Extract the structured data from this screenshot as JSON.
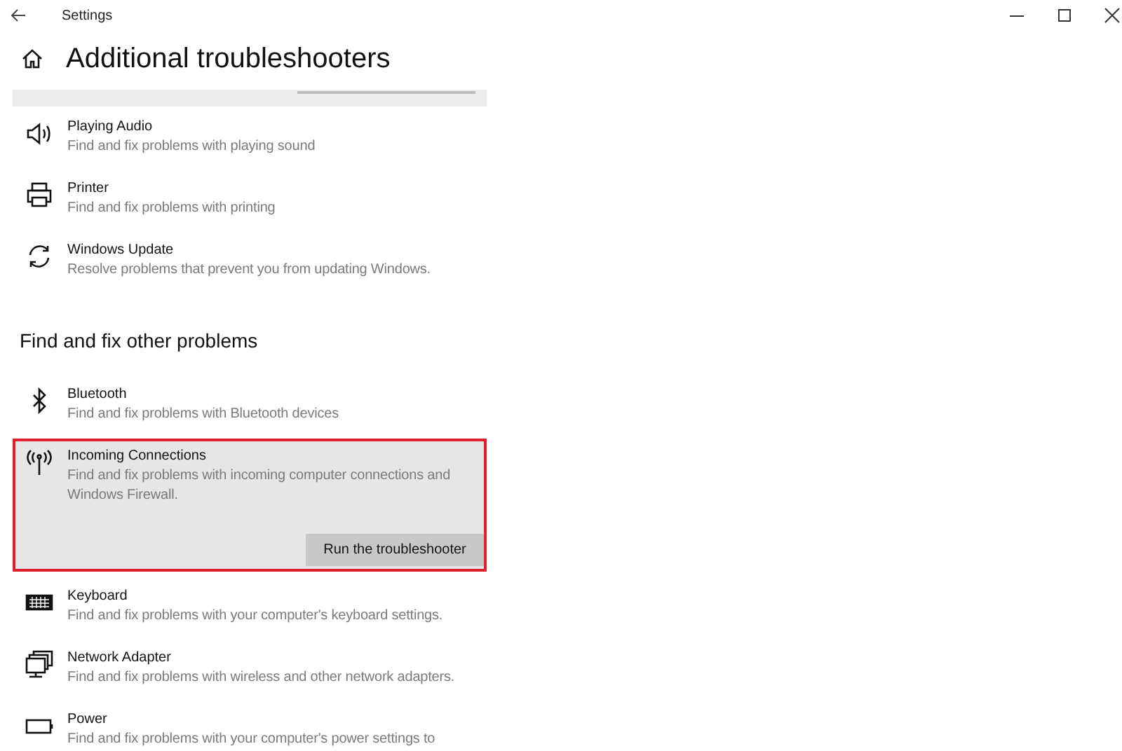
{
  "window": {
    "title": "Settings"
  },
  "page": {
    "title": "Additional troubleshooters"
  },
  "top_items": [
    {
      "title": "Playing Audio",
      "description": "Find and fix problems with playing sound",
      "selected": false
    },
    {
      "title": "Printer",
      "description": "Find and fix problems with printing",
      "selected": false
    },
    {
      "title": "Windows Update",
      "description": "Resolve problems that prevent you from updating Windows.",
      "selected": false
    }
  ],
  "section": {
    "title": "Find and fix other problems"
  },
  "other_items": [
    {
      "title": "Bluetooth",
      "description": "Find and fix problems with Bluetooth devices",
      "selected": false
    },
    {
      "title": "Incoming Connections",
      "description": "Find and fix problems with incoming computer connections and Windows Firewall.",
      "selected": true,
      "button": "Run the troubleshooter"
    },
    {
      "title": "Keyboard",
      "description": "Find and fix problems with your computer's keyboard settings.",
      "selected": false
    },
    {
      "title": "Network Adapter",
      "description": "Find and fix problems with wireless and other network adapters.",
      "selected": false
    },
    {
      "title": "Power",
      "description": "Find and fix problems with your computer's power settings to",
      "selected": false
    }
  ]
}
